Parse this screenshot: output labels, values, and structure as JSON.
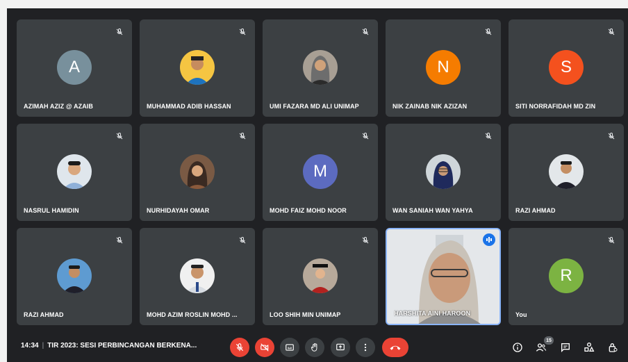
{
  "participants": [
    {
      "name": "AZIMAH AZIZ @ AZAIB",
      "initial": "A",
      "color": "#78909c",
      "type": "initial"
    },
    {
      "name": "MUHAMMAD ADIB HASSAN",
      "type": "photo"
    },
    {
      "name": "UMI FAZARA MD ALI UNIMAP",
      "type": "photo"
    },
    {
      "name": "NIK ZAINAB NIK AZIZAN",
      "initial": "N",
      "color": "#f57c00",
      "type": "initial"
    },
    {
      "name": "SITI NORRAFIDAH MD ZIN",
      "initial": "S",
      "color": "#f4511e",
      "type": "initial"
    },
    {
      "name": "NASRUL HAMIDIN",
      "type": "photo"
    },
    {
      "name": "NURHIDAYAH OMAR",
      "type": "photo"
    },
    {
      "name": "MOHD FAIZ MOHD NOOR",
      "initial": "M",
      "color": "#5c6bc0",
      "type": "initial"
    },
    {
      "name": "WAN SANIAH WAN YAHYA",
      "type": "photo"
    },
    {
      "name": "RAZI AHMAD",
      "type": "photo"
    },
    {
      "name": "RAZI AHMAD",
      "type": "photo"
    },
    {
      "name": "MOHD AZIM ROSLIN MOHD ...",
      "type": "photo"
    },
    {
      "name": "LOO SHIH MIN UNIMAP",
      "type": "photo"
    },
    {
      "name": "HARSHITA AINI HAROON",
      "type": "video"
    },
    {
      "name": "You",
      "initial": "R",
      "color": "#7cb342",
      "type": "initial"
    }
  ],
  "meeting": {
    "time": "14:34",
    "title": "TIR 2023: SESI PERBINCANGAN BERKENA..."
  },
  "participant_count": "15",
  "colors": {
    "background": "#202124",
    "tile": "#3c4043",
    "danger": "#ea4335",
    "speaking": "#1a73e8"
  }
}
